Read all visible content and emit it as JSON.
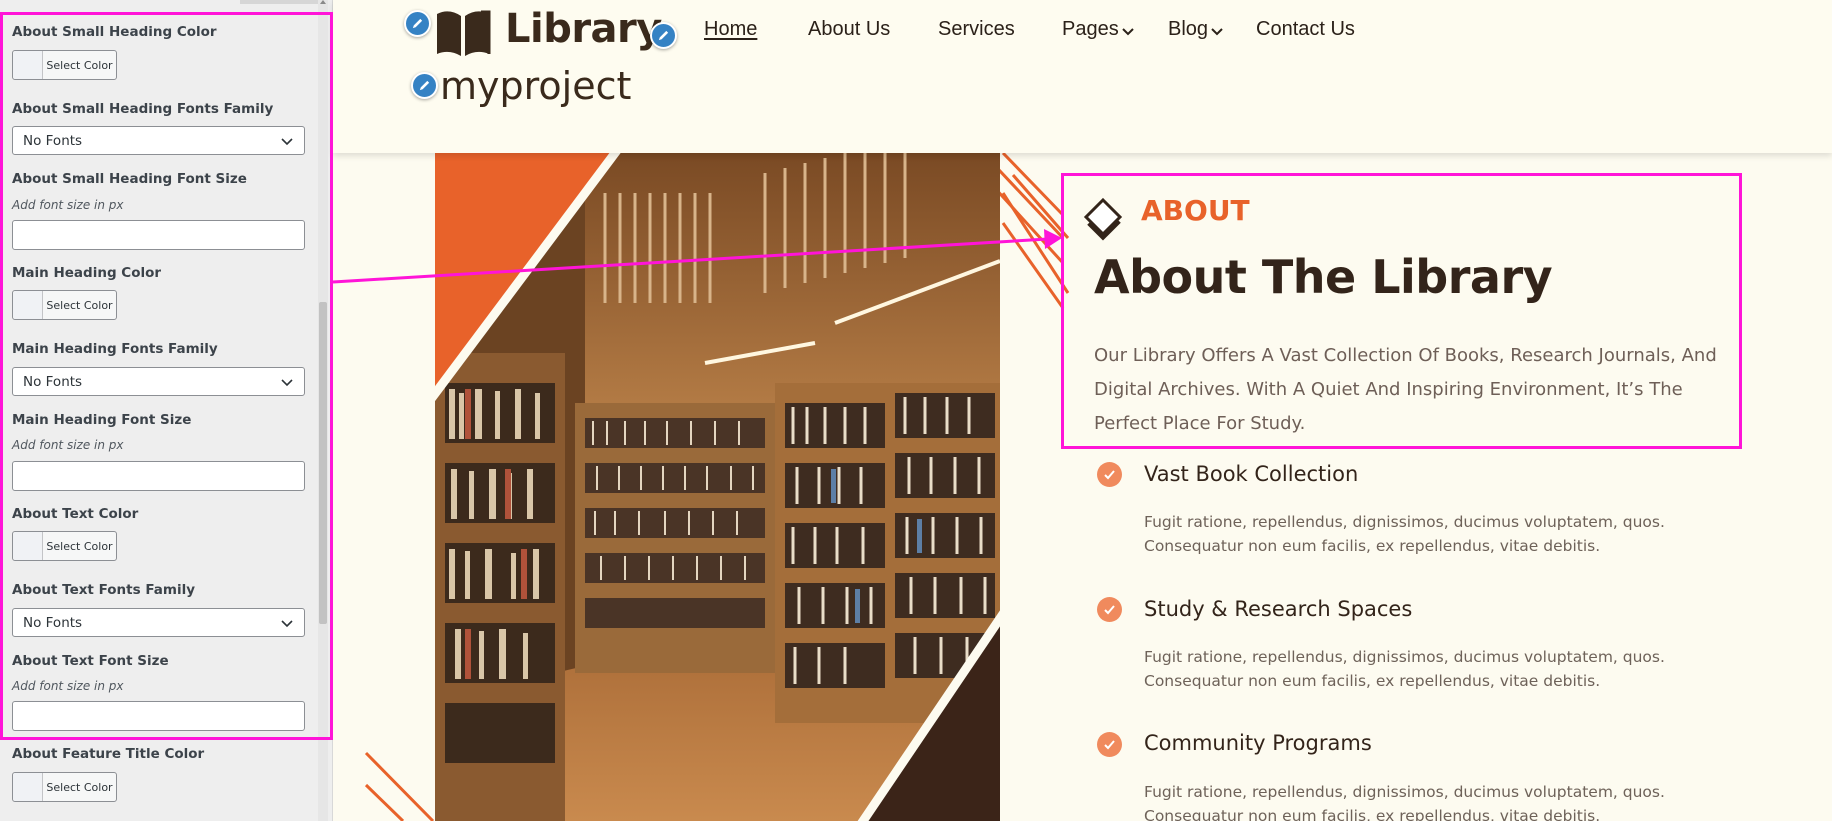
{
  "customizer": {
    "fields": [
      {
        "kind": "color",
        "label": "About Small Heading Color",
        "button": "Select Color"
      },
      {
        "kind": "select",
        "label": "About Small Heading Fonts Family",
        "value": "No Fonts"
      },
      {
        "kind": "text",
        "label": "About Small Heading Font Size",
        "description": "Add font size in px",
        "value": ""
      },
      {
        "kind": "color",
        "label": "Main Heading Color",
        "button": "Select Color"
      },
      {
        "kind": "select",
        "label": "Main Heading Fonts Family",
        "value": "No Fonts"
      },
      {
        "kind": "text",
        "label": "Main Heading Font Size",
        "description": "Add font size in px",
        "value": ""
      },
      {
        "kind": "color",
        "label": "About Text Color",
        "button": "Select Color"
      },
      {
        "kind": "select",
        "label": "About Text Fonts Family",
        "value": "No Fonts"
      },
      {
        "kind": "text",
        "label": "About Text Font Size",
        "description": "Add font size in px",
        "value": ""
      },
      {
        "kind": "color",
        "label": "About Feature Title Color",
        "button": "Select Color"
      }
    ]
  },
  "header": {
    "logo_text": "Library",
    "site_title": "myproject",
    "nav": [
      {
        "label": "Home",
        "active": true,
        "dropdown": false
      },
      {
        "label": "About Us",
        "active": false,
        "dropdown": false
      },
      {
        "label": "Services",
        "active": false,
        "dropdown": false
      },
      {
        "label": "Pages",
        "active": false,
        "dropdown": true
      },
      {
        "label": "Blog",
        "active": false,
        "dropdown": true
      },
      {
        "label": "Contact Us",
        "active": false,
        "dropdown": false
      }
    ]
  },
  "about": {
    "small_heading": "ABOUT",
    "heading": "About The Library",
    "text": "Our Library Offers A Vast Collection Of Books, Research Journals, And Digital Archives. With A Quiet And Inspiring Environment, It’s The Perfect Place For Study.",
    "features": [
      {
        "title": "Vast Book Collection",
        "desc": "Fugit ratione, repellendus, dignissimos, ducimus voluptatem, quos. Consequatur non eum facilis, ex repellendus, vitae debitis."
      },
      {
        "title": "Study & Research Spaces",
        "desc": "Fugit ratione, repellendus, dignissimos, ducimus voluptatem, quos. Consequatur non eum facilis, ex repellendus, vitae debitis."
      },
      {
        "title": "Community Programs",
        "desc": "Fugit ratione, repellendus, dignissimos, ducimus voluptatem, quos. Consequatur non eum facilis, ex repellendus, vitae debitis."
      }
    ]
  },
  "colors": {
    "accent": "#e8622a",
    "dark_brown": "#33241a",
    "highlight": "#ff14d8",
    "edit_pencil": "#3582c4",
    "page_bg": "#fdfbf0"
  },
  "icons": {
    "edit": "pencil-icon",
    "logo": "open-book-icon",
    "section_mark": "book-diamond-icon",
    "check": "check-icon",
    "dropdown": "chevron-down-icon"
  }
}
